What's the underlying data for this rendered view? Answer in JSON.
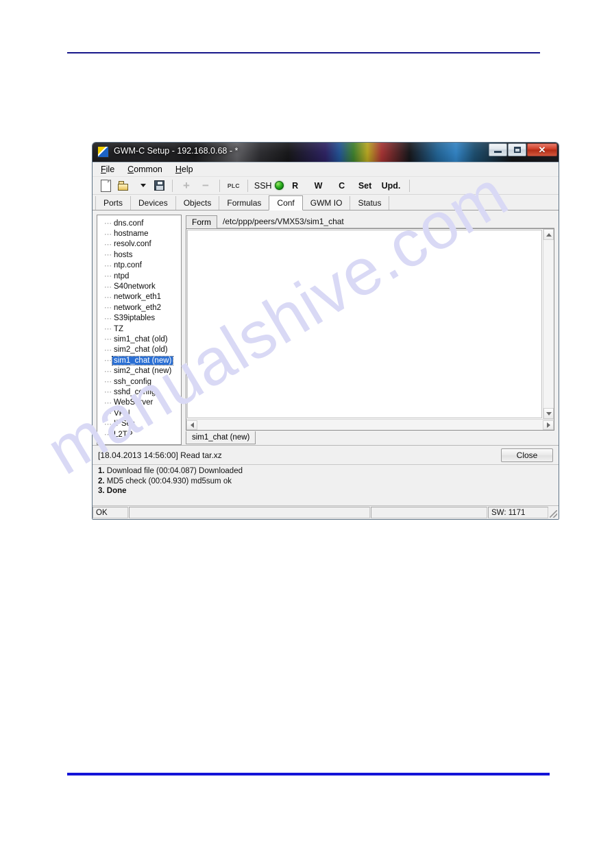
{
  "window": {
    "title": "GWM-C Setup - 192.168.0.68 - *",
    "app_icon": "app-logo-icon",
    "caption": {
      "minimize": "minimize-icon",
      "maximize": "maximize-icon",
      "close": "✕"
    }
  },
  "menubar": {
    "items": [
      {
        "label": "File",
        "accel": "F"
      },
      {
        "label": "Common",
        "accel": "C"
      },
      {
        "label": "Help",
        "accel": "H"
      }
    ]
  },
  "toolbar": {
    "new_icon": "new-document-icon",
    "open_icon": "open-folder-icon",
    "open_dropdown_icon": "chevron-down-icon",
    "save_icon": "save-floppy-icon",
    "add_label": "+",
    "remove_label": "−",
    "plc_label": "PLC",
    "ssh_label": "SSH",
    "ssh_led_color": "#2aa81e",
    "buttons": [
      "R",
      "W",
      "C",
      "Set",
      "Upd."
    ]
  },
  "tabs": {
    "items": [
      "Ports",
      "Devices",
      "Objects",
      "Formulas",
      "Conf",
      "GWM IO",
      "Status"
    ],
    "active": "Conf"
  },
  "tree": {
    "nodes": [
      {
        "label": "dns.conf",
        "selected": false
      },
      {
        "label": "hostname",
        "selected": false
      },
      {
        "label": "resolv.conf",
        "selected": false
      },
      {
        "label": "hosts",
        "selected": false
      },
      {
        "label": "ntp.conf",
        "selected": false
      },
      {
        "label": "ntpd",
        "selected": false
      },
      {
        "label": "S40network",
        "selected": false
      },
      {
        "label": "network_eth1",
        "selected": false
      },
      {
        "label": "network_eth2",
        "selected": false
      },
      {
        "label": "S39iptables",
        "selected": false
      },
      {
        "label": "TZ",
        "selected": false
      },
      {
        "label": "sim1_chat (old)",
        "selected": false
      },
      {
        "label": "sim2_chat (old)",
        "selected": false
      },
      {
        "label": "sim1_chat (new)",
        "selected": true
      },
      {
        "label": "sim2_chat (new)",
        "selected": false
      },
      {
        "label": "ssh_config",
        "selected": false
      },
      {
        "label": "sshd_config",
        "selected": false
      },
      {
        "label": "WebServer",
        "selected": false
      },
      {
        "label": "VPN",
        "selected": false
      },
      {
        "label": "IPSec",
        "selected": false
      },
      {
        "label": "L2TP",
        "selected": false
      }
    ]
  },
  "editor": {
    "form_tab_label": "Form",
    "path": "/etc/ppp/peers/VMX53/sim1_chat",
    "content": "",
    "bottom_tab_label": "sim1_chat (new)"
  },
  "status": {
    "message": "[18.04.2013 14:56:00] Read tar.xz",
    "close_label": "Close"
  },
  "log": {
    "lines": [
      {
        "num": "1.",
        "text": "Download file (00:04.087) Downloaded",
        "bold": false
      },
      {
        "num": "2.",
        "text": "MD5 check (00:04.930) md5sum ok",
        "bold": false
      },
      {
        "num": "3.",
        "text": "Done",
        "bold": true
      }
    ]
  },
  "statusbar": {
    "panel1": "OK",
    "panel2": "",
    "panel3": "",
    "panel4": "SW: 1171"
  },
  "page": {
    "watermark": "manualshive.com"
  }
}
